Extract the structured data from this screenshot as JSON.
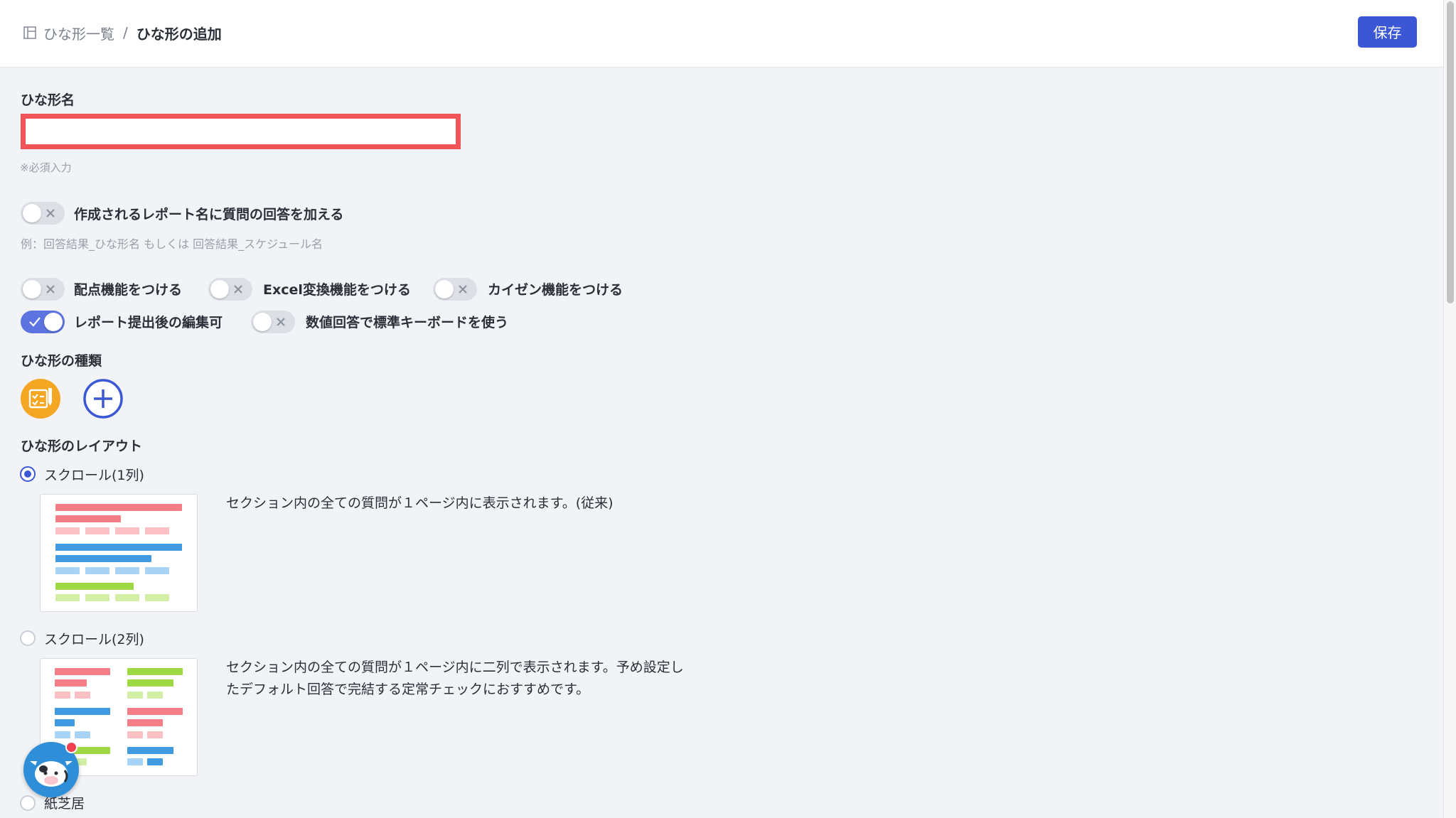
{
  "header": {
    "breadcrumb_parent": "ひな形一覧",
    "breadcrumb_separator": "/",
    "breadcrumb_current": "ひな形の追加",
    "save_label": "保存"
  },
  "name_field": {
    "label": "ひな形名",
    "value": "",
    "required_note": "※必須入力"
  },
  "report_name_toggle": {
    "label": "作成されるレポート名に質問の回答を加える",
    "on": false,
    "example": "例：回答結果_ひな形名 もしくは 回答結果_スケジュール名"
  },
  "feature_toggles": [
    {
      "label": "配点機能をつける",
      "on": false
    },
    {
      "label": "Excel変換機能をつける",
      "on": false
    },
    {
      "label": "カイゼン機能をつける",
      "on": false
    },
    {
      "label": "レポート提出後の編集可",
      "on": true
    },
    {
      "label": "数値回答で標準キーボードを使う",
      "on": false
    }
  ],
  "template_type": {
    "label": "ひな形の種類",
    "icons": [
      "checklist-icon",
      "plus-circle-icon"
    ]
  },
  "layout": {
    "label": "ひな形のレイアウト",
    "options": [
      {
        "label": "スクロール(1列)",
        "checked": true,
        "desc": "セクション内の全ての質問が１ページ内に表示されます。(従来)"
      },
      {
        "label": "スクロール(2列)",
        "checked": false,
        "desc_line1": "セクション内の全ての質問が１ページ内に二列で表示されます。予め設定し",
        "desc_line2": "たデフォルト回答で完結する定常チェックにおすすめです。"
      },
      {
        "label": "紙芝居",
        "checked": false
      }
    ]
  },
  "colors": {
    "accent": "#3b57d6",
    "error_border": "#f15458",
    "toggle_on": "#5c73e0",
    "type_icon": "#f5a623"
  }
}
